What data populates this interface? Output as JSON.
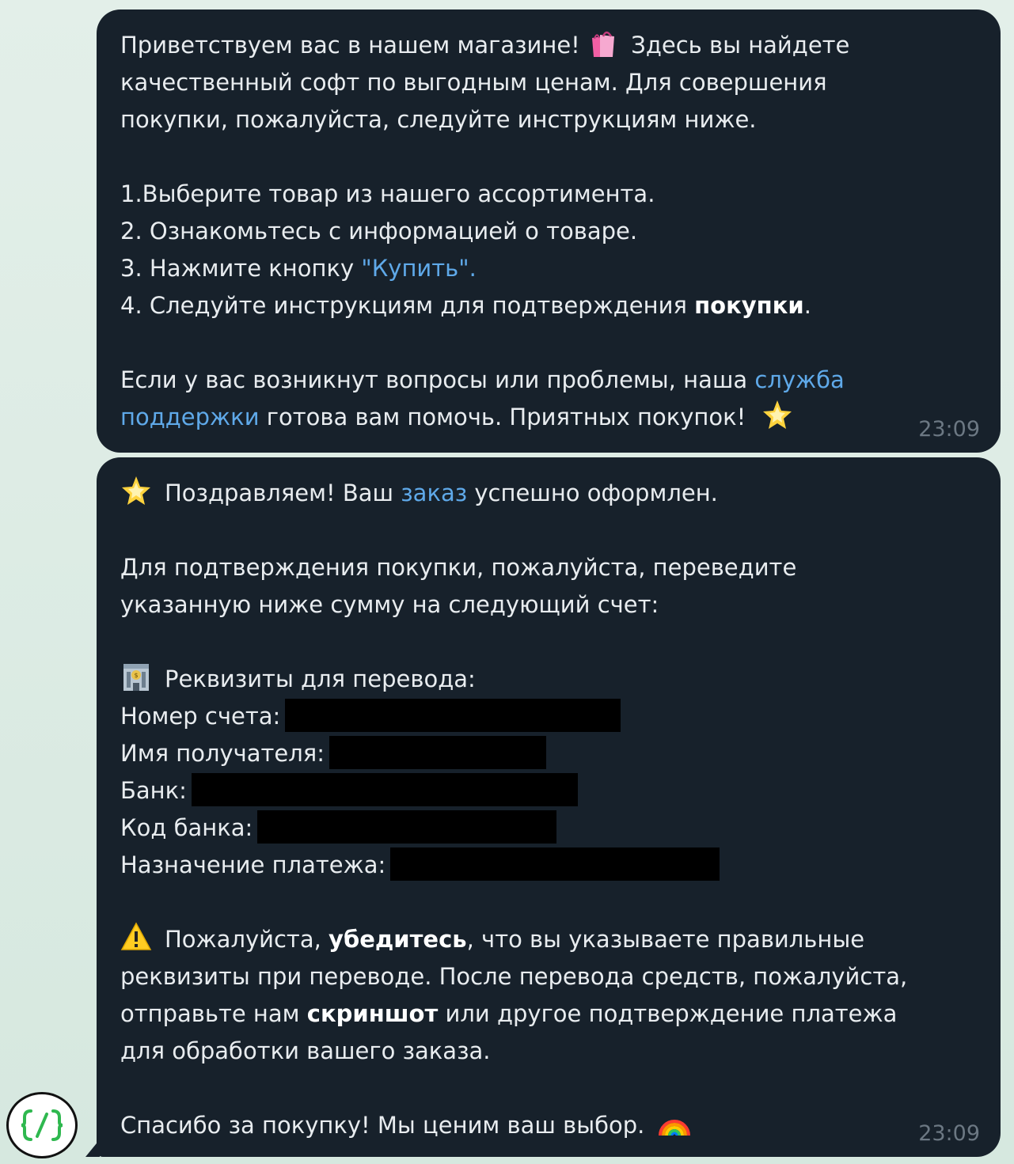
{
  "chat": {
    "messages": [
      {
        "line1_a": "Приветствуем вас в нашем магазине!",
        "line1_b": "Здесь вы найдете",
        "line2": "качественный софт по выгодным ценам. Для совершения",
        "line3": "покупки, пожалуйста, следуйте инструкциям ниже.",
        "step1": "1.Выберите товар из нашего ассортимента.",
        "step2": "2. Ознакомьтесь с информацией о товаре.",
        "step3_a": "3. Нажмите кнопку ",
        "step3_link": "\"Купить\".",
        "step4_a": "4. Следуйте инструкциям для подтверждения ",
        "step4_bold": "покупки",
        "step4_c": ".",
        "support_a": "Если у вас возникнут вопросы или проблемы, наша ",
        "support_link1": "служба",
        "support_link2": "поддержки",
        "support_b": " готова вам помочь. Приятных покупок!",
        "time": "23:09",
        "icons": [
          "shopping-bags-icon",
          "glowing-star-icon"
        ]
      },
      {
        "congrats_a": "Поздравляем! Ваш ",
        "congrats_link": "заказ",
        "congrats_b": " успешно оформлен.",
        "confirm_line1": "Для подтверждения покупки, пожалуйста, переведите",
        "confirm_line2": "указанную ниже сумму на следующий счет:",
        "details_title": "Реквизиты для перевода:",
        "account_label": "Номер счета:",
        "recipient_label": "Имя получателя:",
        "bank_label": "Банк:",
        "bank_code_label": "Код банка:",
        "purpose_label": "Назначение платежа:",
        "warn_a": "Пожалуйста, ",
        "warn_bold1": "убедитесь",
        "warn_b": ", что вы указываете правильные",
        "warn_line2": "реквизиты при переводе. После перевода средств, пожалуйста,",
        "warn_line3_a": "отправьте нам ",
        "warn_bold2": "скриншот",
        "warn_line3_b": " или другое подтверждение платежа",
        "warn_line4": "для обработки вашего заказа.",
        "thanks": "Спасибо за покупку! Мы ценим ваш выбор.",
        "time": "23:09",
        "icons": [
          "glowing-star-icon",
          "bank-icon",
          "warning-icon",
          "rainbow-icon"
        ]
      }
    ]
  },
  "colors": {
    "bubble": "#17212b",
    "text": "#e8ecef",
    "link": "#5fa9e9",
    "time": "#6c7883",
    "redaction": "#000000"
  },
  "logo": {
    "icon": "code-braces-icon"
  }
}
